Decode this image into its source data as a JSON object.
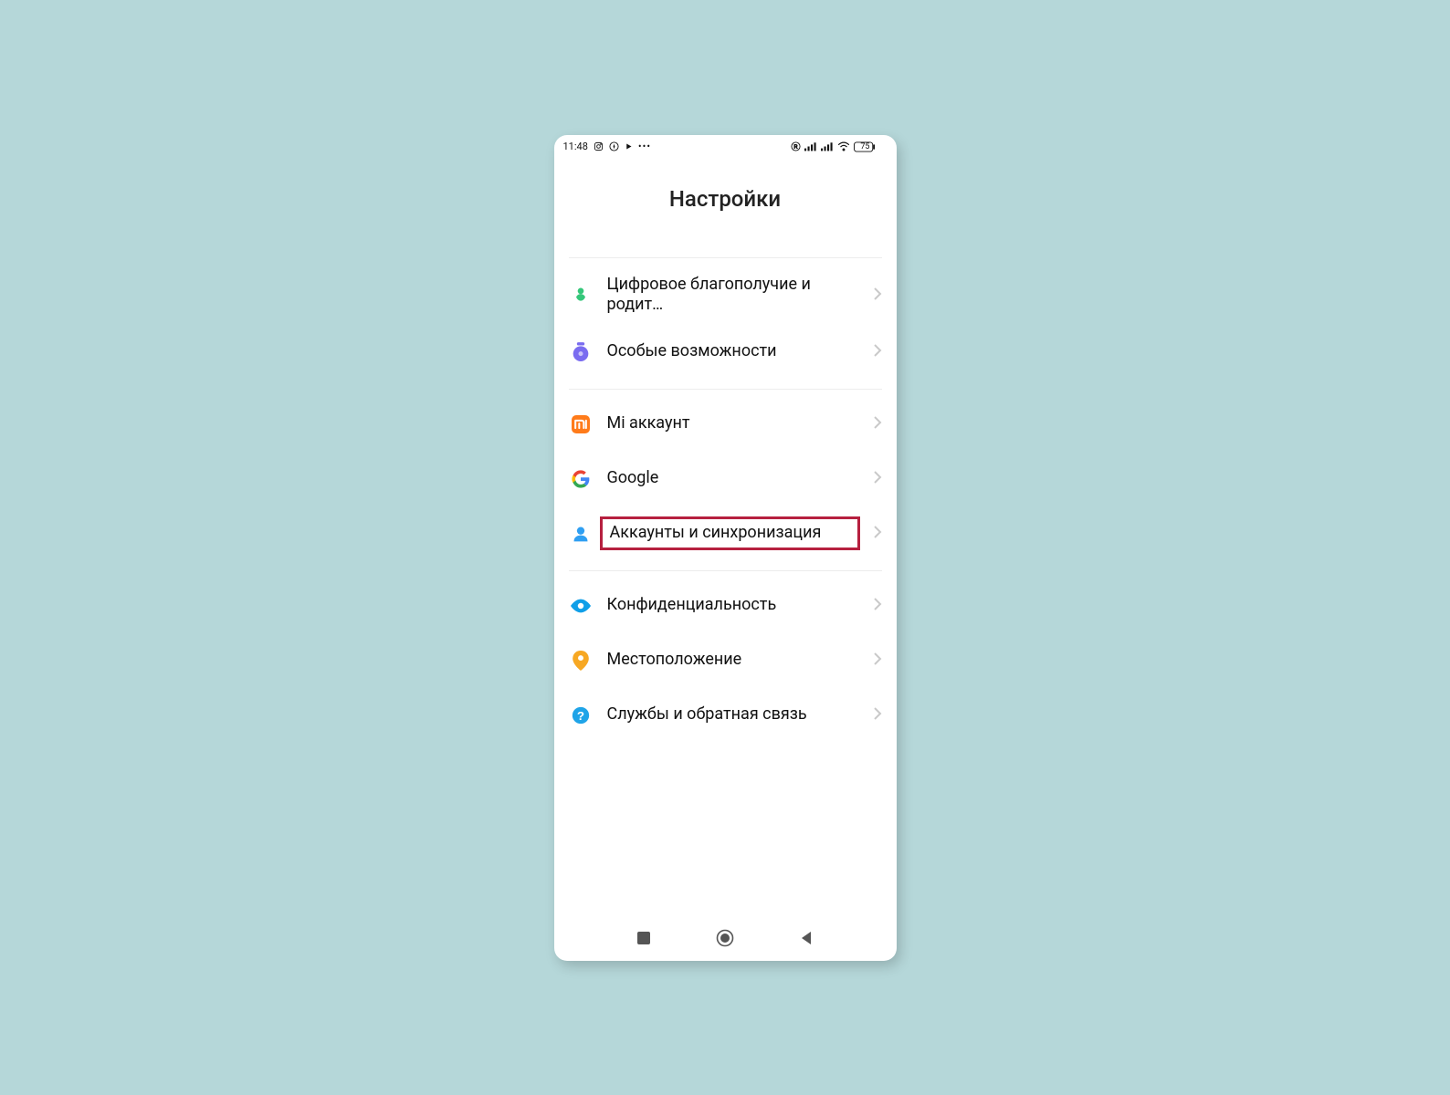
{
  "status": {
    "time": "11:48",
    "battery": "75"
  },
  "title": "Настройки",
  "groups": [
    {
      "items": [
        {
          "id": "wellbeing",
          "label": "Цифровое благополучие и родит…"
        },
        {
          "id": "accessibility",
          "label": "Особые возможности"
        }
      ]
    },
    {
      "items": [
        {
          "id": "mi-account",
          "label": "Mi аккаунт"
        },
        {
          "id": "google",
          "label": "Google"
        },
        {
          "id": "accounts-sync",
          "label": "Аккаунты и синхронизация",
          "highlighted": true
        }
      ]
    },
    {
      "items": [
        {
          "id": "privacy",
          "label": "Конфиденциальность"
        },
        {
          "id": "location",
          "label": "Местоположение"
        },
        {
          "id": "feedback",
          "label": "Службы и обратная связь"
        }
      ]
    }
  ]
}
